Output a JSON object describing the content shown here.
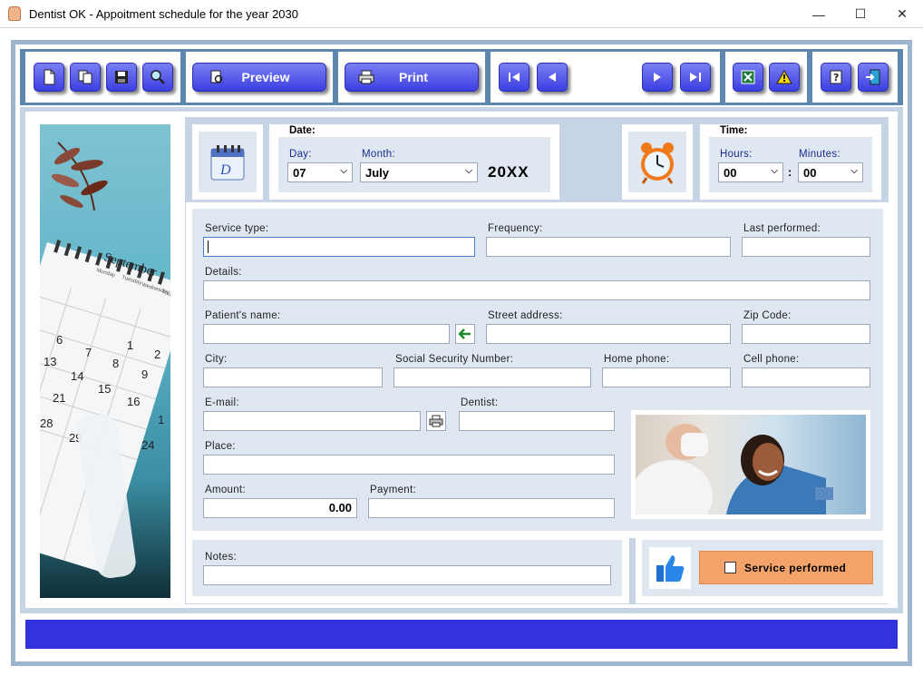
{
  "window": {
    "title": "Dentist OK - Appoitment schedule for the year 2030",
    "minimize": "—",
    "maximize": "☐",
    "close": "✕"
  },
  "toolbar": {
    "preview_label": "Preview",
    "print_label": "Print"
  },
  "date": {
    "group_label": "Date:",
    "day_label": "Day:",
    "day_value": "07",
    "month_label": "Month:",
    "month_value": "July",
    "year_value": "20XX"
  },
  "time": {
    "group_label": "Time:",
    "hours_label": "Hours:",
    "hours_value": "00",
    "separator": ":",
    "minutes_label": "Minutes:",
    "minutes_value": "00"
  },
  "fields": {
    "service_type": "Service type:",
    "frequency": "Frequency:",
    "last_performed": "Last performed:",
    "details": "Details:",
    "patient_name": "Patient's name:",
    "street_address": "Street address:",
    "zip_code": "Zip Code:",
    "city": "City:",
    "ssn": "Social Security Number:",
    "home_phone": "Home phone:",
    "cell_phone": "Cell phone:",
    "email": "E-mail:",
    "dentist": "Dentist:",
    "place": "Place:",
    "amount": "Amount:",
    "amount_value": "0.00",
    "payment": "Payment:",
    "notes": "Notes:"
  },
  "service": {
    "performed_label": "Service performed",
    "performed_checked": false
  },
  "calendar_photo": {
    "month": "September",
    "weekdays": [
      "Monday",
      "Tuesday",
      "Wednesday",
      "Thu"
    ],
    "rows": [
      [
        "",
        "",
        "1",
        "2"
      ],
      [
        "6",
        "7",
        "8",
        "9"
      ],
      [
        "13",
        "14",
        "15",
        "16"
      ],
      [
        "21",
        "",
        "",
        "1"
      ],
      [
        "28",
        "29",
        "",
        "24"
      ]
    ]
  },
  "colors": {
    "accent": "#3333dd",
    "button_blue": "#5a5ef0",
    "frame": "#c6d4e5",
    "service_button": "#f4a46a"
  }
}
